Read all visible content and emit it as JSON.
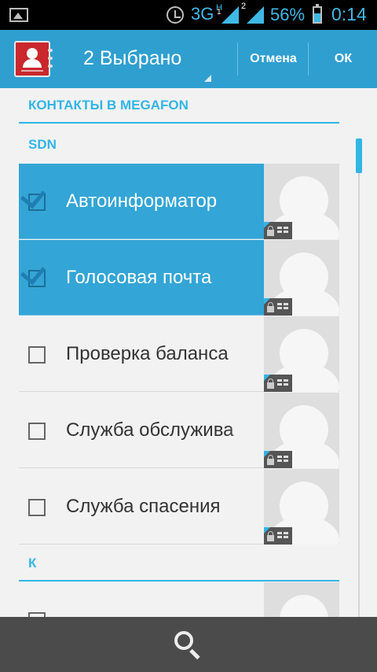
{
  "status_bar": {
    "network": "3G",
    "network_activity": "H",
    "sim1_label": "1",
    "sim2_label": "2",
    "battery_percent": "56%",
    "time": "0:14",
    "icons": [
      "picture-icon",
      "alarm-icon",
      "signal-icon",
      "battery-icon"
    ]
  },
  "action_bar": {
    "title": "2 Выбрано",
    "cancel_label": "Отмена",
    "ok_label": "ОК",
    "color": "#2f9fd0"
  },
  "sections": [
    {
      "title": "КОНТАКТЫ В MEGAFON"
    },
    {
      "title": "SDN"
    },
    {
      "title": "К"
    }
  ],
  "contacts": [
    {
      "name": "Автоинформатор",
      "checked": true
    },
    {
      "name": "Голосовая почта",
      "checked": true
    },
    {
      "name": "Проверка баланса",
      "checked": false
    },
    {
      "name": "Служба обслужива",
      "checked": false
    },
    {
      "name": "Служба спасения",
      "checked": false
    },
    {
      "name": "",
      "checked": false
    }
  ],
  "bottom_bar": {
    "icon": "search-icon"
  },
  "colors": {
    "accent": "#33b5e5",
    "selected_row": "#33a5d6",
    "bottom_bar": "#4b4b4b"
  }
}
